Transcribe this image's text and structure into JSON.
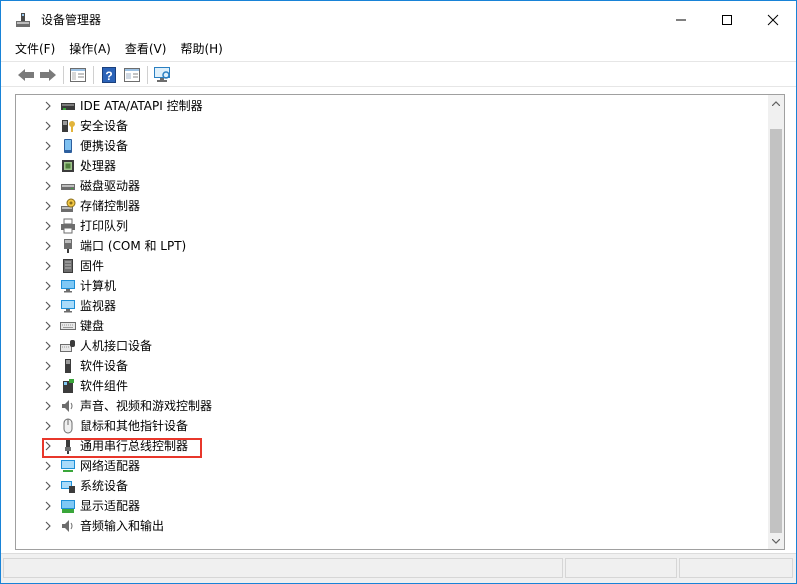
{
  "window": {
    "title": "设备管理器",
    "border_color": "#1883d7",
    "app_icon": "device-manager-icon",
    "controls": {
      "minimize": "minimize-icon",
      "maximize": "maximize-icon",
      "close": "close-icon"
    }
  },
  "menu": [
    {
      "id": "file",
      "label": "文件(F)"
    },
    {
      "id": "action",
      "label": "操作(A)"
    },
    {
      "id": "view",
      "label": "查看(V)"
    },
    {
      "id": "help",
      "label": "帮助(H)"
    }
  ],
  "toolbar": [
    {
      "id": "back",
      "icon": "back-arrow-icon"
    },
    {
      "id": "forward",
      "icon": "forward-arrow-icon"
    },
    {
      "id": "show-hide-console-tree",
      "icon": "console-tree-icon"
    },
    {
      "id": "help",
      "icon": "help-icon"
    },
    {
      "id": "properties",
      "icon": "properties-icon"
    },
    {
      "id": "scan",
      "icon": "monitor-scan-icon"
    }
  ],
  "tree": {
    "items": [
      {
        "label": "IDE ATA/ATAPI 控制器",
        "icon": "ide-controller-icon"
      },
      {
        "label": "安全设备",
        "icon": "security-device-icon"
      },
      {
        "label": "便携设备",
        "icon": "portable-device-icon"
      },
      {
        "label": "处理器",
        "icon": "processor-icon"
      },
      {
        "label": "磁盘驱动器",
        "icon": "disk-drive-icon"
      },
      {
        "label": "存储控制器",
        "icon": "storage-controller-icon"
      },
      {
        "label": "打印队列",
        "icon": "printer-icon"
      },
      {
        "label": "端口 (COM 和 LPT)",
        "icon": "port-icon"
      },
      {
        "label": "固件",
        "icon": "firmware-icon"
      },
      {
        "label": "计算机",
        "icon": "computer-icon"
      },
      {
        "label": "监视器",
        "icon": "monitor-icon"
      },
      {
        "label": "键盘",
        "icon": "keyboard-icon"
      },
      {
        "label": "人机接口设备",
        "icon": "hid-icon"
      },
      {
        "label": "软件设备",
        "icon": "software-device-icon"
      },
      {
        "label": "软件组件",
        "icon": "software-component-icon"
      },
      {
        "label": "声音、视频和游戏控制器",
        "icon": "sound-icon"
      },
      {
        "label": "鼠标和其他指针设备",
        "icon": "mouse-icon"
      },
      {
        "label": "通用串行总线控制器",
        "icon": "usb-controller-icon",
        "highlighted": true
      },
      {
        "label": "网络适配器",
        "icon": "network-adapter-icon"
      },
      {
        "label": "系统设备",
        "icon": "system-device-icon"
      },
      {
        "label": "显示适配器",
        "icon": "display-adapter-icon"
      },
      {
        "label": "音频输入和输出",
        "icon": "audio-io-icon"
      }
    ],
    "highlight_color": "#e8372b"
  }
}
